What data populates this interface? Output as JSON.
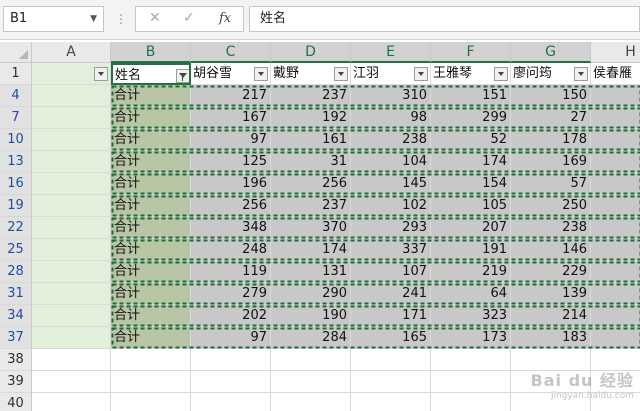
{
  "formula_bar": {
    "name_box": "B1",
    "cancel_icon": "cancel-x-icon",
    "enter_icon": "checkmark-icon",
    "fx_label": "fx",
    "formula_value": "姓名"
  },
  "columns": [
    "A",
    "B",
    "C",
    "D",
    "E",
    "F",
    "G",
    "H"
  ],
  "rows": [
    "1",
    "4",
    "7",
    "10",
    "13",
    "16",
    "19",
    "22",
    "25",
    "28",
    "31",
    "34",
    "37",
    "38",
    "39",
    "40"
  ],
  "table": {
    "headers": [
      "",
      "姓名",
      "胡谷雪",
      "戴野",
      "江羽",
      "王雅琴",
      "廖问筠",
      "侯春雁"
    ],
    "filter_active_column": "B",
    "data_rows": [
      [
        "合计",
        "217",
        "237",
        "310",
        "151",
        "150"
      ],
      [
        "合计",
        "167",
        "192",
        "98",
        "299",
        "27"
      ],
      [
        "合计",
        "97",
        "161",
        "238",
        "52",
        "178"
      ],
      [
        "合计",
        "125",
        "31",
        "104",
        "174",
        "169"
      ],
      [
        "合计",
        "196",
        "256",
        "145",
        "154",
        "57"
      ],
      [
        "合计",
        "256",
        "237",
        "102",
        "105",
        "250"
      ],
      [
        "合计",
        "348",
        "370",
        "293",
        "207",
        "238"
      ],
      [
        "合计",
        "248",
        "174",
        "337",
        "191",
        "146"
      ],
      [
        "合计",
        "119",
        "131",
        "107",
        "219",
        "229"
      ],
      [
        "合计",
        "279",
        "290",
        "241",
        "64",
        "139"
      ],
      [
        "合计",
        "202",
        "190",
        "171",
        "323",
        "214"
      ],
      [
        "合计",
        "97",
        "284",
        "165",
        "173",
        "183"
      ]
    ]
  },
  "watermark": {
    "text": "Bai du 经验",
    "sub": "jingyan.baidu.com"
  },
  "colors": {
    "accent_green": "#217346",
    "copy_marquee": "#1e6b3a",
    "column_a_fill": "#e2efda",
    "selected_fill": "#b8c6a6",
    "data_fill": "#c8c8c8"
  }
}
